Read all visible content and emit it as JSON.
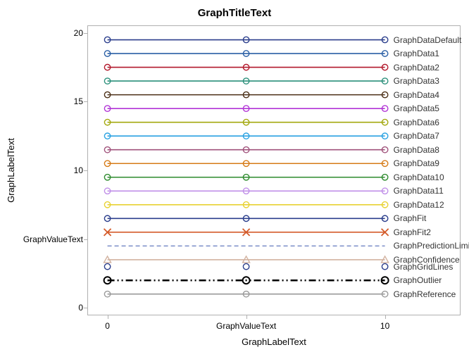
{
  "chart_data": {
    "type": "line",
    "title": "GraphTitleText",
    "xlabel": "GraphLabelText",
    "ylabel": "GraphLabelText",
    "x": [
      0,
      5,
      10
    ],
    "x_tick_values": [
      0,
      5,
      10
    ],
    "x_tick_labels": [
      "0",
      "GraphValueText",
      "10"
    ],
    "xlim": [
      -0.7,
      12.7
    ],
    "y_tick_values": [
      0,
      5,
      10,
      15,
      20
    ],
    "y_tick_labels": [
      "0",
      "GraphValueText",
      "10",
      "15",
      "20"
    ],
    "ylim": [
      -0.5,
      20.5
    ],
    "series": [
      {
        "name": "GraphDataDefault",
        "y": 19.5,
        "color": "#2b3e8c",
        "line": "solid",
        "marker": "circle",
        "thick": false
      },
      {
        "name": "GraphData1",
        "y": 18.5,
        "color": "#2a5fa5",
        "line": "solid",
        "marker": "circle",
        "thick": false
      },
      {
        "name": "GraphData2",
        "y": 17.5,
        "color": "#b2182b",
        "line": "solid",
        "marker": "circle",
        "thick": false
      },
      {
        "name": "GraphData3",
        "y": 16.5,
        "color": "#2a8f7a",
        "line": "solid",
        "marker": "circle",
        "thick": false
      },
      {
        "name": "GraphData4",
        "y": 15.5,
        "color": "#4a2e15",
        "line": "solid",
        "marker": "circle",
        "thick": false
      },
      {
        "name": "GraphData5",
        "y": 14.5,
        "color": "#b133d6",
        "line": "solid",
        "marker": "circle",
        "thick": false
      },
      {
        "name": "GraphData6",
        "y": 13.5,
        "color": "#a3a80e",
        "line": "solid",
        "marker": "circle",
        "thick": false
      },
      {
        "name": "GraphData7",
        "y": 12.5,
        "color": "#2aa2e2",
        "line": "solid",
        "marker": "circle",
        "thick": false
      },
      {
        "name": "GraphData8",
        "y": 11.5,
        "color": "#a0527b",
        "line": "solid",
        "marker": "circle",
        "thick": false
      },
      {
        "name": "GraphData9",
        "y": 10.5,
        "color": "#d67b17",
        "line": "solid",
        "marker": "circle",
        "thick": false
      },
      {
        "name": "GraphData10",
        "y": 9.5,
        "color": "#2e8b2e",
        "line": "solid",
        "marker": "circle",
        "thick": false
      },
      {
        "name": "GraphData11",
        "y": 8.5,
        "color": "#c08fe8",
        "line": "solid",
        "marker": "circle",
        "thick": false
      },
      {
        "name": "GraphData12",
        "y": 7.5,
        "color": "#e8d233",
        "line": "solid",
        "marker": "circle",
        "thick": false
      },
      {
        "name": "GraphFit",
        "y": 6.5,
        "color": "#2b3e8c",
        "line": "solid",
        "marker": "circle",
        "thick": false
      },
      {
        "name": "GraphFit2",
        "y": 5.5,
        "color": "#d45b2a",
        "line": "solid",
        "marker": "xmark",
        "thick": false
      },
      {
        "name": "GraphPredictionLimits",
        "y": 4.5,
        "color": "#7a8cc7",
        "line": "dashed",
        "marker": "none",
        "thick": false
      },
      {
        "name": "GraphConfidence",
        "y": 3.5,
        "color": "#d2b2a0",
        "line": "solid",
        "marker": "triangle",
        "thick": false
      },
      {
        "name": "GraphGridLines",
        "y": 3.0,
        "color": "#2b3e8c",
        "line": "none",
        "marker": "circle",
        "thick": false
      },
      {
        "name": "GraphOutlier",
        "y": 2.0,
        "color": "#000000",
        "line": "dashdot2",
        "marker": "circle",
        "thick": true
      },
      {
        "name": "GraphReference",
        "y": 1.0,
        "color": "#9a9a9a",
        "line": "solid",
        "marker": "circle",
        "thick": false
      }
    ]
  }
}
